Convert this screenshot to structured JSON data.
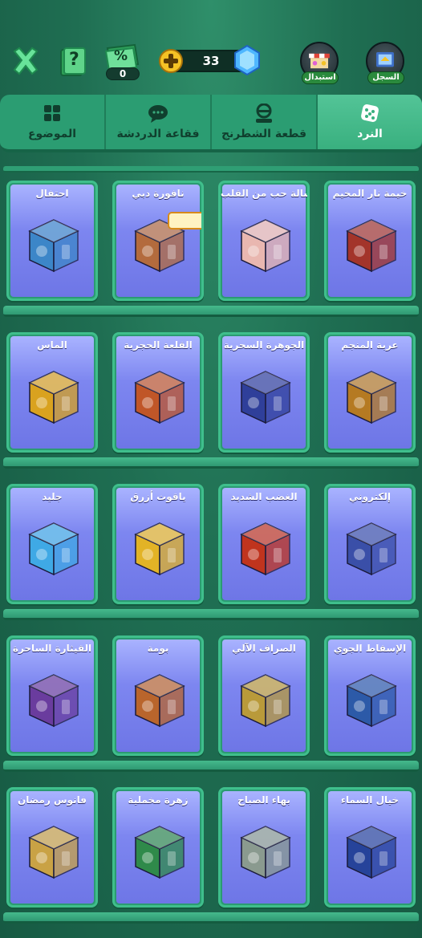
{
  "topbar": {
    "percent_count": "0",
    "gem_count": "33",
    "exchange_label": "استبدال",
    "history_label": "السجل",
    "percent_symbol": "%",
    "help_symbol": "?"
  },
  "tabs": [
    {
      "label": "النرد",
      "active": true,
      "icon": "dice-icon"
    },
    {
      "label": "قطعة الشطرنج",
      "active": false,
      "icon": "chess-piece-icon"
    },
    {
      "label": "فقاعة الدردشة",
      "active": false,
      "icon": "chat-bubble-icon"
    },
    {
      "label": "الموضوع",
      "active": false,
      "icon": "theme-grid-icon"
    }
  ],
  "rows": [
    [
      "خيمة نار المخيم",
      "رسالة حب من القلب",
      "نافورة دبي",
      "احتفال"
    ],
    [
      "عربة المنجم",
      "الجوهرة السحرية",
      "القلعة الحجرية",
      "الماس"
    ],
    [
      "إلكتروني",
      "الغضب الشديد",
      "ياقوت أزرق",
      "جليد"
    ],
    [
      "الإسقاط الجوي",
      "الصراف الآلي",
      "بومة",
      "القيثارة الساحرة"
    ],
    [
      "خيال السماء",
      "بهاء الصباح",
      "زهرة مخملية",
      "فانوس رمضان"
    ]
  ],
  "dice_colors": [
    [
      "#a3342a",
      "#e9b7b0",
      "#b36b3d",
      "#3c86c8"
    ],
    [
      "#b57a22",
      "#2f3f9a",
      "#c05628",
      "#d9a21f"
    ],
    [
      "#3a4fa8",
      "#c0341e",
      "#e2b326",
      "#3fa9e5"
    ],
    [
      "#2c5aa8",
      "#b99a3a",
      "#b9652c",
      "#6a3c9e"
    ],
    [
      "#26439a",
      "#8a9a8f",
      "#2f8a4a",
      "#c9a245"
    ]
  ],
  "colors": {
    "background": "#1f6e52",
    "card_inner": "#7d86f0",
    "active_tab": "#45bb8a"
  }
}
